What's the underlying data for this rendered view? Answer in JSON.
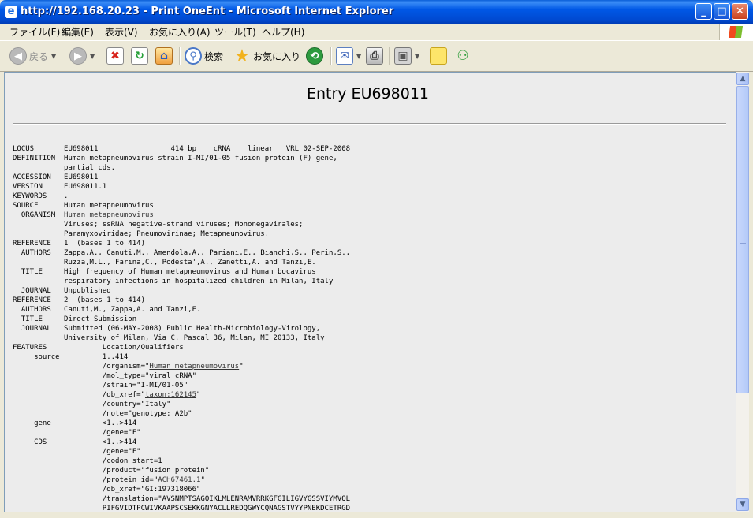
{
  "window": {
    "title": "http://192.168.20.23 - Print OneEnt - Microsoft Internet Explorer",
    "controls": {
      "minimize": "_",
      "maximize": "□",
      "close": "✕"
    }
  },
  "menu": [
    "ファイル(F)",
    "編集(E)",
    "表示(V)",
    "お気に入り(A)",
    "ツール(T)",
    "ヘルプ(H)"
  ],
  "toolbar": {
    "back": "戻る",
    "search": "検索",
    "favorites": "お気に入り"
  },
  "icons": {
    "back": "back-arrow-icon",
    "forward": "forward-arrow-icon",
    "stop": "stop-icon",
    "refresh": "refresh-icon",
    "home": "home-icon",
    "search": "magnifier-icon",
    "favorites": "star-icon",
    "history": "history-icon",
    "mail": "mail-icon",
    "print": "printer-icon",
    "edit": "edit-icon",
    "discuss": "notes-icon",
    "messenger": "messenger-icon"
  },
  "colors": {
    "titlebar": "#0058e6",
    "page_bg": "#ececec",
    "link": "#333333"
  },
  "page": {
    "title": "Entry EU698011",
    "record": [
      {
        "k": "LOCUS",
        "t": "EU698011                 414 bp    cRNA    linear   VRL 02-SEP-2008"
      },
      {
        "k": "DEFINITION",
        "t": "Human metapneumovirus strain I-MI/01-05 fusion protein (F) gene,"
      },
      {
        "k": "",
        "t": "partial cds."
      },
      {
        "k": "ACCESSION",
        "t": "EU698011"
      },
      {
        "k": "VERSION",
        "t": "EU698011.1"
      },
      {
        "k": "KEYWORDS",
        "t": "."
      },
      {
        "k": "SOURCE",
        "t": "Human metapneumovirus"
      },
      {
        "k": "  ORGANISM",
        "t": "",
        "link": "Human metapneumovirus"
      },
      {
        "k": "",
        "t": "Viruses; ssRNA negative-strand viruses; Mononegavirales;"
      },
      {
        "k": "",
        "t": "Paramyxoviridae; Pneumovirinae; Metapneumovirus."
      },
      {
        "k": "REFERENCE",
        "t": "1  (bases 1 to 414)"
      },
      {
        "k": "  AUTHORS",
        "t": "Zappa,A., Canuti,M., Amendola,A., Pariani,E., Bianchi,S., Perin,S.,"
      },
      {
        "k": "",
        "t": "Ruzza,M.L., Farina,C., Podesta',A., Zanetti,A. and Tanzi,E."
      },
      {
        "k": "  TITLE",
        "t": "High frequency of Human metapneumovirus and Human bocavirus"
      },
      {
        "k": "",
        "t": "respiratory infections in hospitalized children in Milan, Italy"
      },
      {
        "k": "  JOURNAL",
        "t": "Unpublished"
      },
      {
        "k": "REFERENCE",
        "t": "2  (bases 1 to 414)"
      },
      {
        "k": "  AUTHORS",
        "t": "Canuti,M., Zappa,A. and Tanzi,E."
      },
      {
        "k": "  TITLE",
        "t": "Direct Submission"
      },
      {
        "k": "  JOURNAL",
        "t": "Submitted (06-MAY-2008) Public Health-Microbiology-Virology,"
      },
      {
        "k": "",
        "t": "University of Milan, Via C. Pascal 36, Milan, MI 20133, Italy"
      },
      {
        "k": "FEATURES",
        "t": "         Location/Qualifiers"
      },
      {
        "k": "     source",
        "t": "         1..414"
      },
      {
        "k": "",
        "t": "         /organism=\"",
        "link": "Human metapneumovirus",
        "after": "\""
      },
      {
        "k": "",
        "t": "         /mol_type=\"viral cRNA\""
      },
      {
        "k": "",
        "t": "         /strain=\"I-MI/01-05\""
      },
      {
        "k": "",
        "t": "         /db_xref=\"",
        "link": "taxon:162145",
        "after": "\""
      },
      {
        "k": "",
        "t": "         /country=\"Italy\""
      },
      {
        "k": "",
        "t": "         /note=\"genotype: A2b\""
      },
      {
        "k": "     gene",
        "t": "         <1..>414"
      },
      {
        "k": "",
        "t": "         /gene=\"F\""
      },
      {
        "k": "     CDS",
        "t": "         <1..>414"
      },
      {
        "k": "",
        "t": "         /gene=\"F\""
      },
      {
        "k": "",
        "t": "         /codon_start=1"
      },
      {
        "k": "",
        "t": "         /product=\"fusion protein\""
      },
      {
        "k": "",
        "t": "         /protein_id=\"",
        "link": "ACH67461.1",
        "after": "\""
      },
      {
        "k": "",
        "t": "         /db_xref=\"GI:197318066\""
      },
      {
        "k": "",
        "t": "         /translation=\"AVSNMPTSAGQIKLMLENRAMVRRKGFGILIGVYGSSVIYMVQL"
      },
      {
        "k": "",
        "t": "         PIFGVIDTPCWIVKAAPSCSEKKGNYACLLREDQGWYCQNAGSTVYYPNEKDCETRGD"
      }
    ]
  }
}
